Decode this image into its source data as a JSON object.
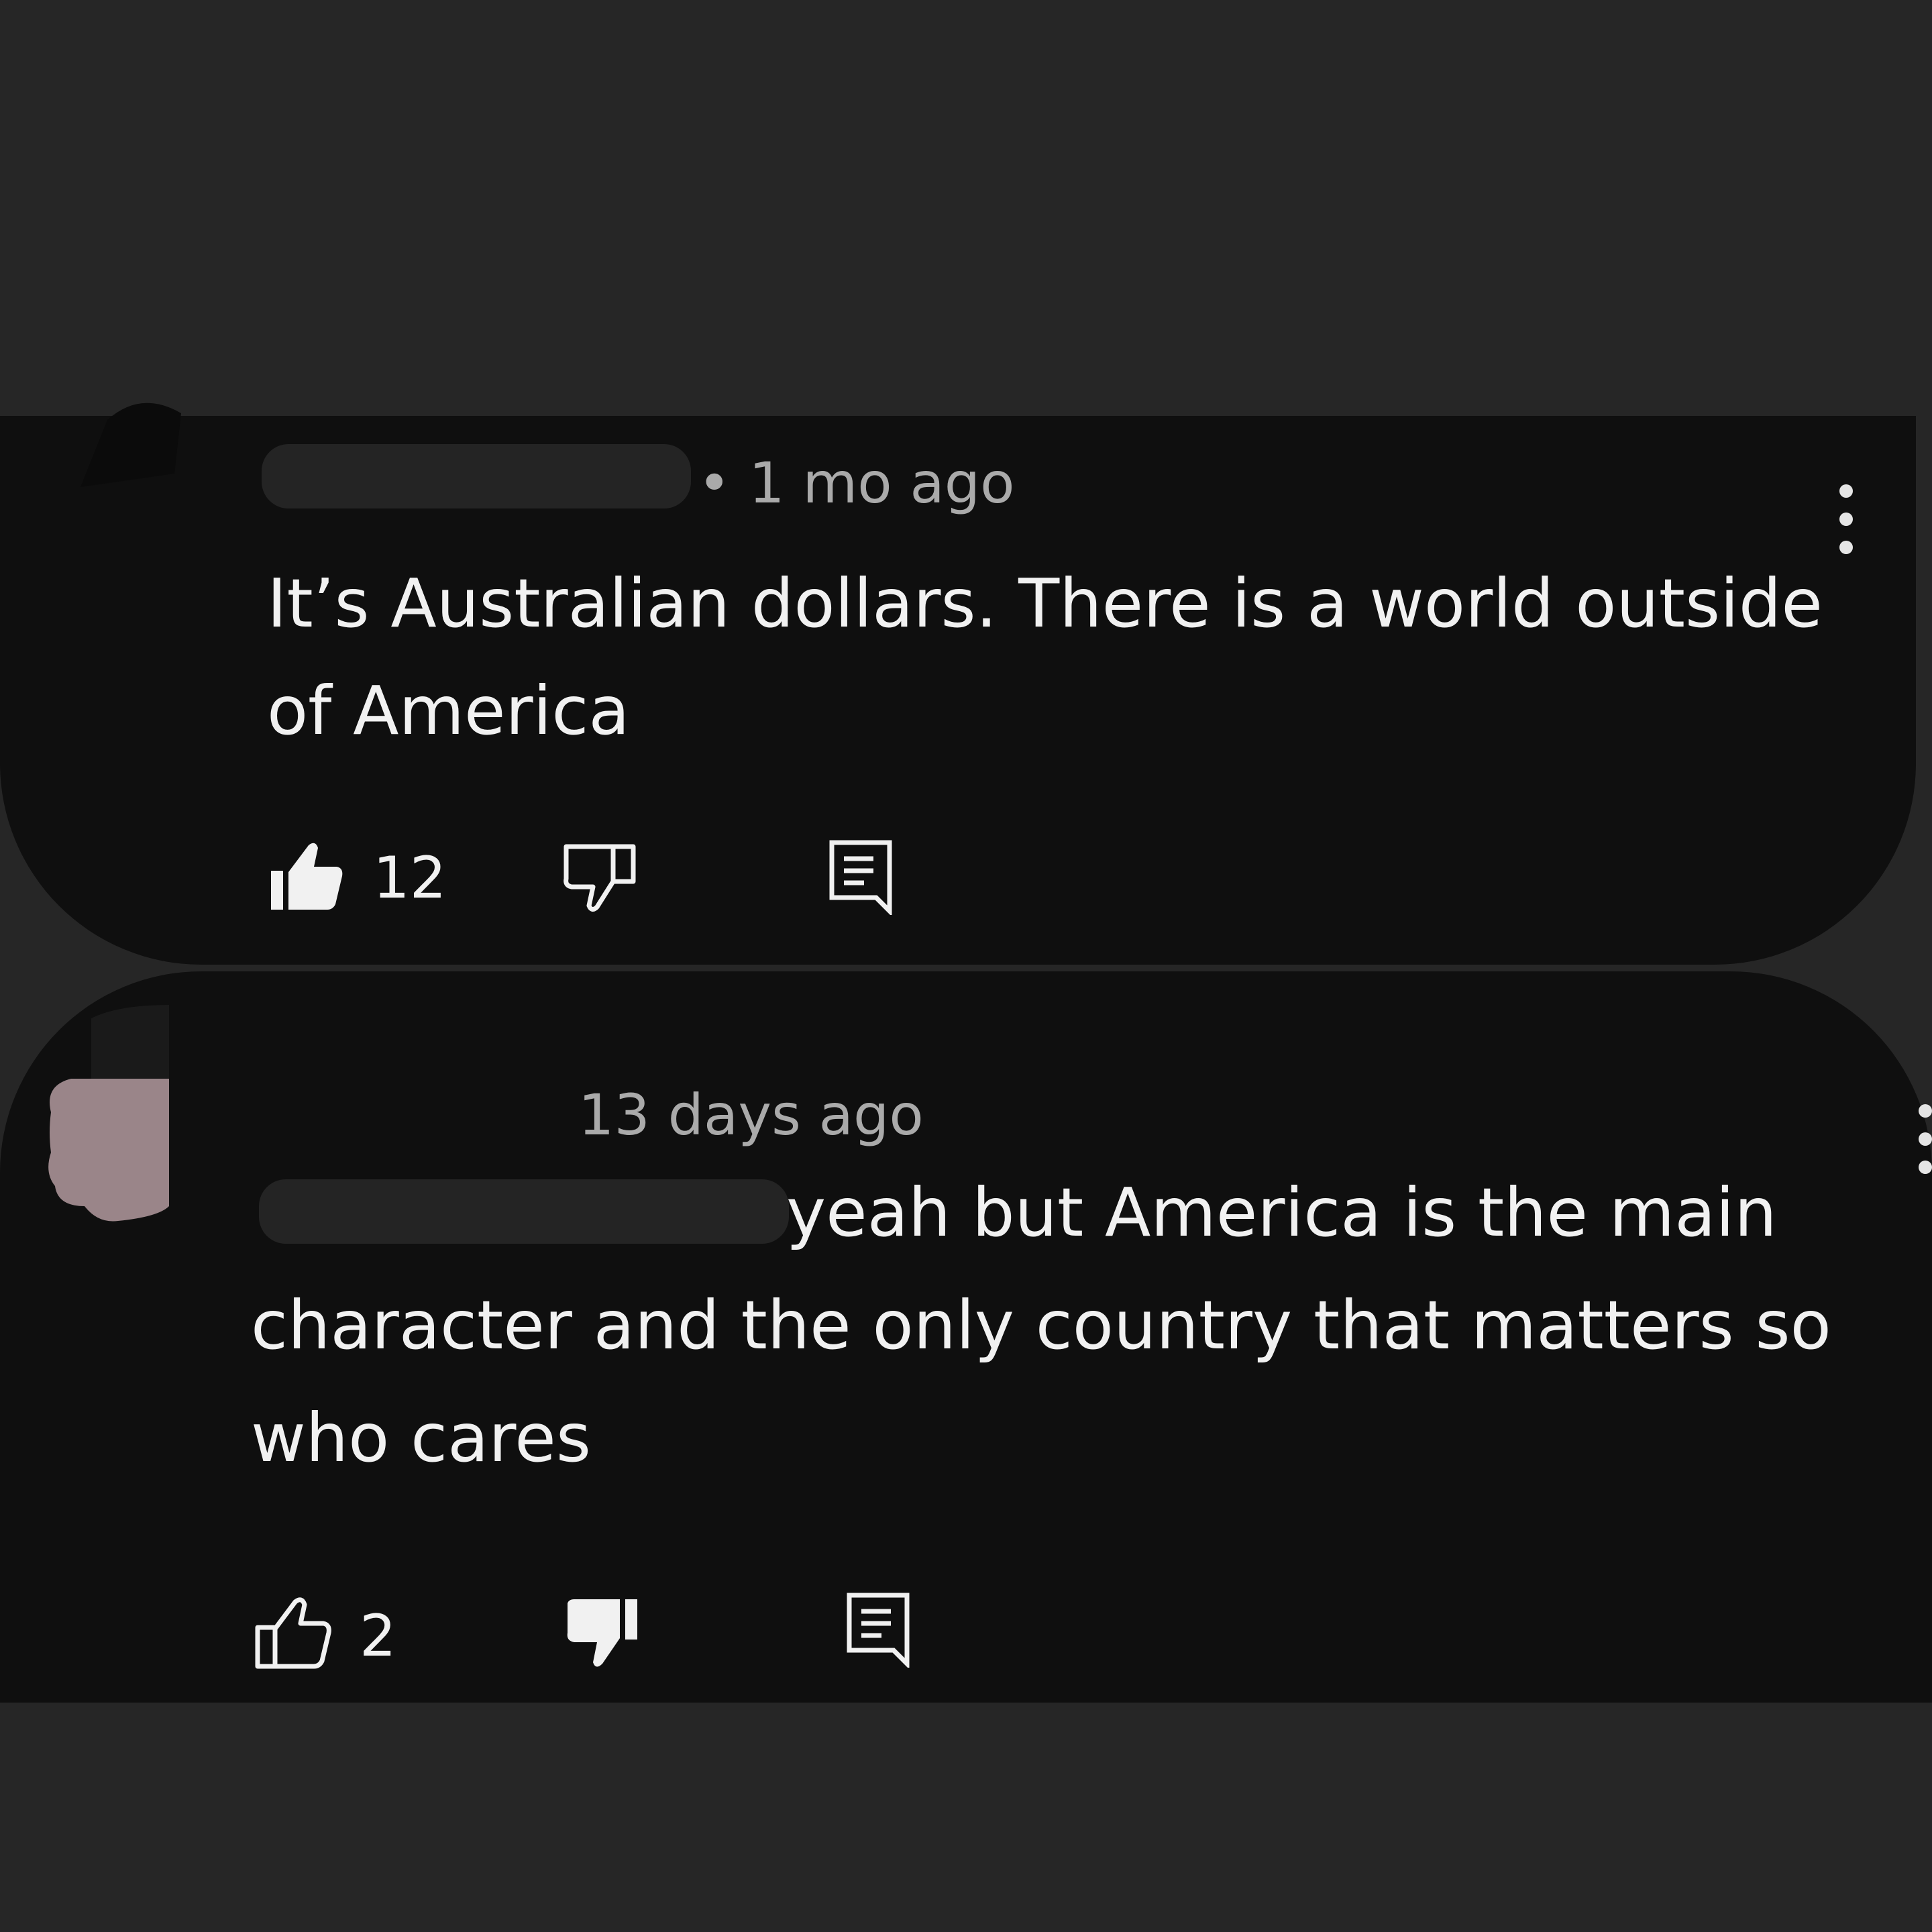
{
  "comments": [
    {
      "timestamp": "• 1 mo ago",
      "text_line1": "It’s Australian dollars. There is a world outside",
      "text_line2": "of America",
      "like_count": "12",
      "liked": true,
      "disliked": false
    },
    {
      "timestamp": "13 days ago",
      "text_line1": "yeah but America is the main",
      "text_line2": "character and the only country that matters so",
      "text_line3": "who cares",
      "like_count": "2",
      "liked": false,
      "disliked": true
    }
  ],
  "colors": {
    "background": "#262626",
    "card": "#0f0f0f",
    "text": "#f1f1f1",
    "meta_text": "#aaaaaa",
    "avatar": "#9a8589"
  },
  "icons": {
    "like": "thumbs-up-icon",
    "dislike": "thumbs-down-icon",
    "reply": "reply-comment-icon",
    "menu": "more-vert-icon"
  }
}
